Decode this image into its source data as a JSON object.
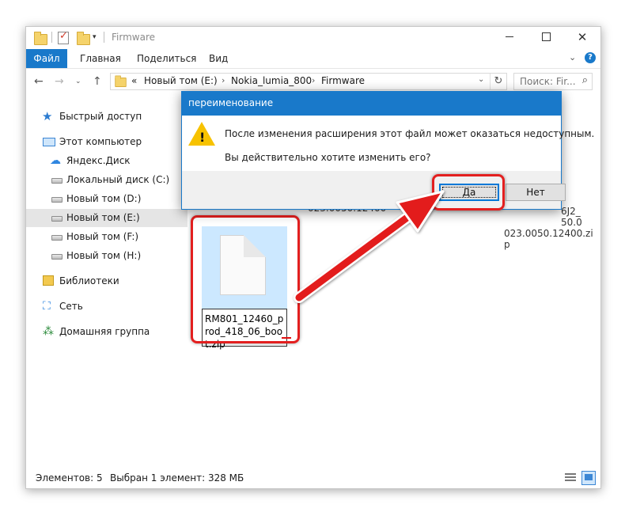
{
  "window": {
    "title": "Firmware",
    "controls": {
      "minimize": "",
      "maximize": "",
      "close": "✕"
    }
  },
  "ribbon": {
    "tabs": [
      "Файл",
      "Главная",
      "Поделиться",
      "Вид"
    ],
    "help": "?"
  },
  "address": {
    "prefix": "«",
    "crumbs": [
      "Новый том (E:)",
      "Nokia_lumia_800",
      "Firmware"
    ],
    "search_placeholder": "Поиск: Fir..."
  },
  "sidebar": {
    "items": [
      {
        "label": "Быстрый доступ",
        "icon": "star-icon"
      },
      {
        "label": "Этот компьютер",
        "icon": "computer-icon"
      },
      {
        "label": "Яндекс.Диск",
        "icon": "cloud-icon"
      },
      {
        "label": "Локальный диск (C:)",
        "icon": "drive-icon"
      },
      {
        "label": "Новый том (D:)",
        "icon": "drive-icon"
      },
      {
        "label": "Новый том (E:)",
        "icon": "drive-icon",
        "selected": true
      },
      {
        "label": "Новый том (F:)",
        "icon": "drive-icon"
      },
      {
        "label": "Новый том (H:)",
        "icon": "drive-icon"
      },
      {
        "label": "Библиотеки",
        "icon": "library-icon"
      },
      {
        "label": "Сеть",
        "icon": "network-icon"
      },
      {
        "label": "Домашняя группа",
        "icon": "homegroup-icon"
      }
    ]
  },
  "files": {
    "partial_left_text": "023.0050.12400",
    "partial_right_lines": [
      "6J2_",
      "50.0",
      "023.0050.12400.zi",
      "p"
    ],
    "renaming_file": {
      "name": "RM801_12460_prod_418_06_boot.zip",
      "extension": "zip"
    }
  },
  "status": {
    "count": "Элементов: 5",
    "selection": "Выбран 1 элемент: 328 МБ"
  },
  "dialog": {
    "title": "переименование",
    "message_line1": "После изменения расширения этот файл может оказаться недоступным.",
    "message_line2": "Вы действительно хотите изменить его?",
    "yes_label": "Да",
    "no_label": "Нет"
  },
  "colors": {
    "accent": "#1979ca",
    "annotation": "#e31f1f",
    "warning": "#f7c200",
    "selection": "#cce8ff"
  }
}
